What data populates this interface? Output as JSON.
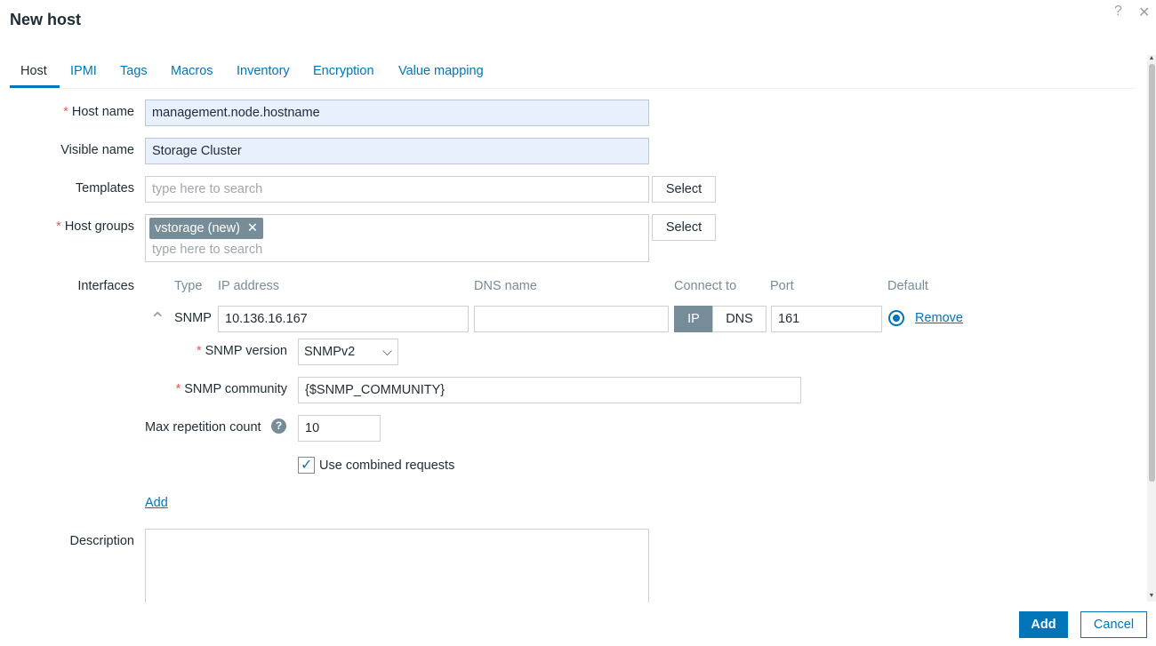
{
  "dialog": {
    "title": "New host",
    "help_glyph": "?",
    "close_glyph": "✕"
  },
  "tabs": [
    {
      "label": "Host",
      "active": true
    },
    {
      "label": "IPMI"
    },
    {
      "label": "Tags"
    },
    {
      "label": "Macros"
    },
    {
      "label": "Inventory"
    },
    {
      "label": "Encryption"
    },
    {
      "label": "Value mapping"
    }
  ],
  "form": {
    "host_name": {
      "label": "Host name",
      "required": true,
      "value": "management.node.hostname"
    },
    "visible_name": {
      "label": "Visible name",
      "value": "Storage Cluster"
    },
    "templates": {
      "label": "Templates",
      "placeholder": "type here to search",
      "button": "Select"
    },
    "host_groups": {
      "label": "Host groups",
      "required": true,
      "chips": [
        "vstorage (new)"
      ],
      "chip_remove_glyph": "✕",
      "placeholder": "type here to search",
      "button": "Select"
    },
    "interfaces": {
      "label": "Interfaces",
      "columns": {
        "type": "Type",
        "ip": "IP address",
        "dns": "DNS name",
        "connect": "Connect to",
        "port": "Port",
        "default": "Default"
      },
      "rows": [
        {
          "collapse_glyph": "⌃",
          "type": "SNMP",
          "ip": "10.136.16.167",
          "dns": "",
          "connect_options": [
            "IP",
            "DNS"
          ],
          "connect_selected": "IP",
          "port": "161",
          "default_selected": true,
          "remove_label": "Remove",
          "snmp_version": {
            "label": "SNMP version",
            "required": true,
            "value": "SNMPv2",
            "caret": "⌵"
          },
          "snmp_community": {
            "label": "SNMP community",
            "required": true,
            "value": "{$SNMP_COMMUNITY}"
          },
          "max_repetition": {
            "label": "Max repetition count",
            "help_glyph": "?",
            "value": "10"
          },
          "combined_requests": {
            "label": "Use combined requests",
            "checked": true,
            "check_glyph": "✓"
          }
        }
      ],
      "add_label": "Add"
    },
    "description": {
      "label": "Description",
      "value": ""
    }
  },
  "footer": {
    "add_button": "Add",
    "cancel_button": "Cancel"
  },
  "colors": {
    "accent": "#0275b8",
    "required": "#e45959",
    "chip_bg": "#768d99",
    "autofill_bg": "#e8f0fe"
  }
}
